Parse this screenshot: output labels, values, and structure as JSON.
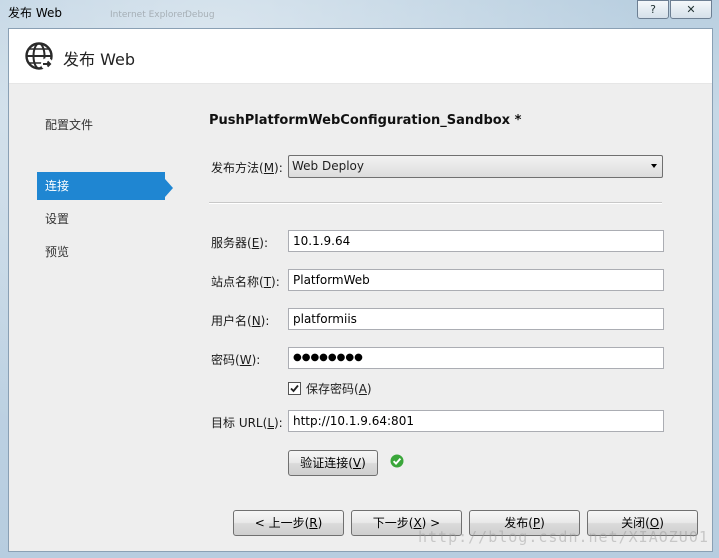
{
  "window": {
    "title": "发布 Web",
    "help_glyph": "?",
    "close_glyph": "✕"
  },
  "header": {
    "title": "发布 Web"
  },
  "nav": {
    "items": [
      {
        "label": "配置文件"
      },
      {
        "label": "连接"
      },
      {
        "label": "设置"
      },
      {
        "label": "预览"
      }
    ]
  },
  "profile_name": "PushPlatformWebConfiguration_Sandbox *",
  "form": {
    "method": {
      "label_pre": "发布方法(",
      "key": "M",
      "label_post": "):",
      "value": "Web Deploy"
    },
    "server": {
      "label_pre": "服务器(",
      "key": "E",
      "label_post": "):",
      "value": "10.1.9.64"
    },
    "site": {
      "label_pre": "站点名称(",
      "key": "T",
      "label_post": "):",
      "value": "PlatformWeb"
    },
    "user": {
      "label_pre": "用户名(",
      "key": "N",
      "label_post": "):",
      "value": "platformiis"
    },
    "password": {
      "label_pre": "密码(",
      "key": "W",
      "label_post": "):",
      "value": "●●●●●●●●"
    },
    "save_password": {
      "label_pre": "保存密码(",
      "key": "A",
      "label_post": ")",
      "checked": true
    },
    "url": {
      "label_pre": "目标 URL(",
      "key": "L",
      "label_post": "):",
      "value": "http://10.1.9.64:801"
    },
    "verify": {
      "label_pre": "验证连接(",
      "key": "V",
      "label_post": ")"
    }
  },
  "footer": {
    "prev": {
      "label_pre": "< 上一步(",
      "key": "R",
      "label_post": ")"
    },
    "next": {
      "label_pre": "下一步(",
      "key": "X",
      "label_post": ") >"
    },
    "publish": {
      "label_pre": "发布(",
      "key": "P",
      "label_post": ")"
    },
    "close": {
      "label_pre": "关闭(",
      "key": "O",
      "label_post": ")"
    }
  },
  "watermark": "http://blog.csdn.net/XIAOZU01",
  "colors": {
    "accent": "#1f86d2",
    "success": "#3aa63a"
  },
  "icons": {
    "header": "globe-icon",
    "verify_status": "check-circle-icon",
    "checkbox": "checkmark-icon"
  }
}
